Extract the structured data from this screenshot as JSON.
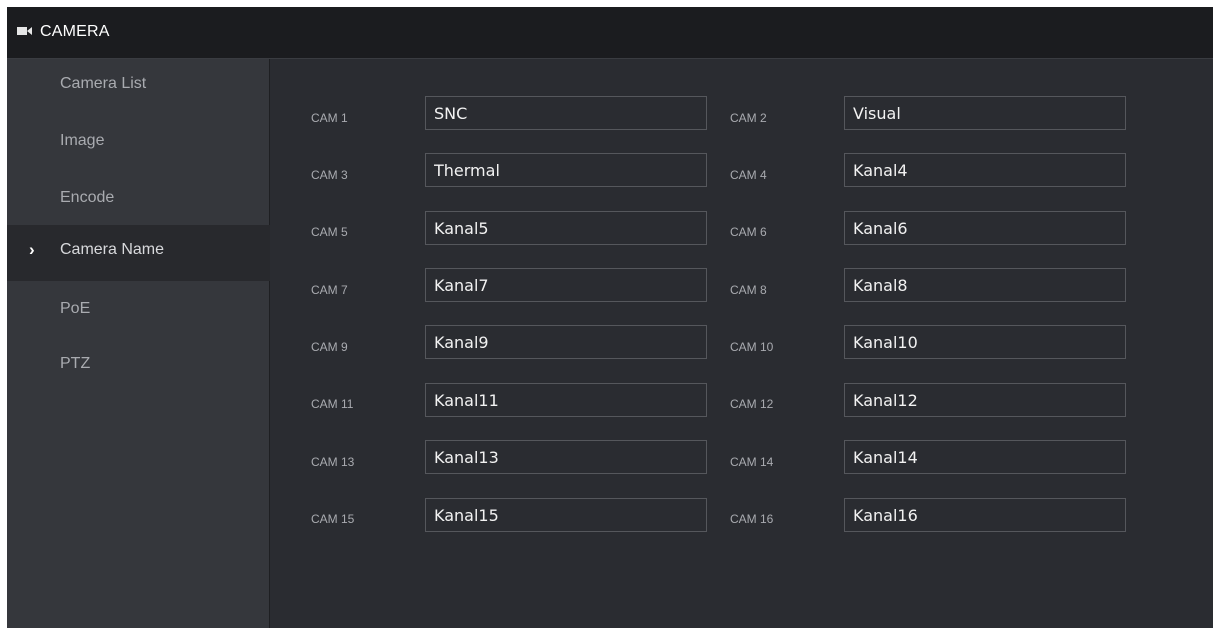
{
  "header": {
    "title": "CAMERA",
    "icon": "video-camera-icon"
  },
  "sidebar": {
    "items": [
      {
        "label": "Camera List",
        "active": false
      },
      {
        "label": "Image",
        "active": false
      },
      {
        "label": "Encode",
        "active": false
      },
      {
        "label": "Camera Name",
        "active": true
      },
      {
        "label": "PoE",
        "active": false
      },
      {
        "label": "PTZ",
        "active": false
      }
    ],
    "active_marker": "›"
  },
  "cameras": [
    {
      "label": "CAM 1",
      "value": "SNC"
    },
    {
      "label": "CAM 2",
      "value": "Visual"
    },
    {
      "label": "CAM 3",
      "value": "Thermal"
    },
    {
      "label": "CAM 4",
      "value": "Kanal4"
    },
    {
      "label": "CAM 5",
      "value": "Kanal5"
    },
    {
      "label": "CAM 6",
      "value": "Kanal6"
    },
    {
      "label": "CAM 7",
      "value": "Kanal7"
    },
    {
      "label": "CAM 8",
      "value": "Kanal8"
    },
    {
      "label": "CAM 9",
      "value": "Kanal9"
    },
    {
      "label": "CAM 10",
      "value": "Kanal10"
    },
    {
      "label": "CAM 11",
      "value": "Kanal11"
    },
    {
      "label": "CAM 12",
      "value": "Kanal12"
    },
    {
      "label": "CAM 13",
      "value": "Kanal13"
    },
    {
      "label": "CAM 14",
      "value": "Kanal14"
    },
    {
      "label": "CAM 15",
      "value": "Kanal15"
    },
    {
      "label": "CAM 16",
      "value": "Kanal16"
    }
  ],
  "colors": {
    "titlebar_bg": "#1b1c1f",
    "sidebar_bg": "#35373c",
    "sidebar_active_bg": "#28292d",
    "content_bg": "#2a2c31",
    "input_border": "#55575c",
    "text_muted": "#a9abb0",
    "text_bright": "#f2f2f2"
  }
}
